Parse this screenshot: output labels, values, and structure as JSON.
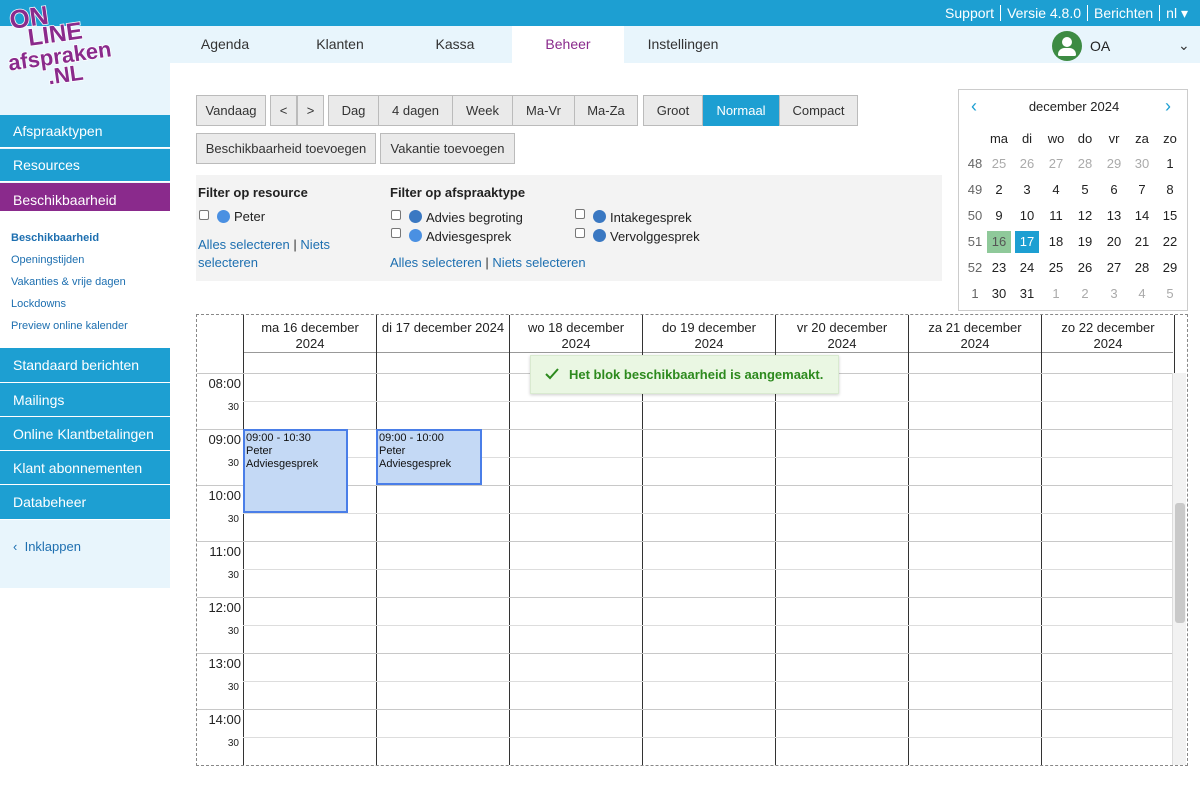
{
  "topbar": {
    "support": "Support",
    "version": "Versie 4.8.0",
    "messages": "Berichten",
    "lang": "nl ▾"
  },
  "logo": {
    "line1": "ON",
    "line2": "LINE",
    "line3": "afspraken",
    "line4": ".NL"
  },
  "nav": [
    "Agenda",
    "Klanten",
    "Kassa",
    "Beheer",
    "Instellingen"
  ],
  "user": {
    "initials": "OA"
  },
  "sidebar": {
    "top": [
      "Afspraaktypen",
      "Resources",
      "Beschikbaarheid"
    ],
    "sub": [
      "Beschikbaarheid",
      "Openingstijden",
      "Vakanties & vrije dagen",
      "Lockdowns",
      "Preview online kalender"
    ],
    "bottom": [
      "Standaard berichten",
      "Mailings",
      "Online Klantbetalingen",
      "Klant abonnementen",
      "Databeheer"
    ],
    "collapse": "Inklappen"
  },
  "toolbar": {
    "today": "Vandaag",
    "prev": "<",
    "next": ">",
    "views": [
      "Dag",
      "4 dagen",
      "Week",
      "Ma-Vr",
      "Ma-Za"
    ],
    "sizes": [
      "Groot",
      "Normaal",
      "Compact"
    ],
    "add_avail": "Beschikbaarheid toevoegen",
    "add_vac": "Vakantie toevoegen"
  },
  "filter": {
    "resource_title": "Filter op resource",
    "resources": [
      {
        "name": "Peter",
        "color": "#4a90e2"
      }
    ],
    "resource_links": {
      "all": "Alles selecteren",
      "sep": "|",
      "none": "Niets",
      "none2": "selecteren"
    },
    "type_title": "Filter op afspraaktype",
    "types": [
      {
        "name": "Advies begroting",
        "color": "#3a78c2"
      },
      {
        "name": "Intakegesprek",
        "color": "#3a78c2"
      },
      {
        "name": "Adviesgesprek",
        "color": "#4a90e2"
      },
      {
        "name": "Vervolggesprek",
        "color": "#3a78c2"
      }
    ],
    "type_links": {
      "all": "Alles selecteren",
      "sep": "|",
      "none": "Niets selecteren"
    }
  },
  "minical": {
    "month": "december 2024",
    "weekdays": [
      "ma",
      "di",
      "wo",
      "do",
      "vr",
      "za",
      "zo"
    ],
    "weeks": [
      {
        "wk": "48",
        "days": [
          "25",
          "26",
          "27",
          "28",
          "29",
          "30",
          "1"
        ]
      },
      {
        "wk": "49",
        "days": [
          "2",
          "3",
          "4",
          "5",
          "6",
          "7",
          "8"
        ]
      },
      {
        "wk": "50",
        "days": [
          "9",
          "10",
          "11",
          "12",
          "13",
          "14",
          "15"
        ]
      },
      {
        "wk": "51",
        "days": [
          "16",
          "17",
          "18",
          "19",
          "20",
          "21",
          "22"
        ]
      },
      {
        "wk": "52",
        "days": [
          "23",
          "24",
          "25",
          "26",
          "27",
          "28",
          "29"
        ]
      },
      {
        "wk": "1",
        "days": [
          "30",
          "31",
          "1",
          "2",
          "3",
          "4",
          "5"
        ]
      }
    ]
  },
  "calendar": {
    "days": [
      {
        "l1": "ma 16 december",
        "l2": "2024"
      },
      {
        "l1": "di 17 december 2024",
        "l2": ""
      },
      {
        "l1": "wo 18 december",
        "l2": "2024"
      },
      {
        "l1": "do 19 december",
        "l2": "2024"
      },
      {
        "l1": "vr 20 december",
        "l2": "2024"
      },
      {
        "l1": "za 21 december",
        "l2": "2024"
      },
      {
        "l1": "zo 22 december",
        "l2": "2024"
      }
    ],
    "hours": [
      "08:00",
      "09:00",
      "10:00",
      "11:00",
      "12:00",
      "13:00",
      "14:00"
    ],
    "half": "30",
    "events": [
      {
        "day": 0,
        "time": "09:00 - 10:30",
        "who": "Peter",
        "type": "Adviesgesprek",
        "start_min": 60,
        "dur_min": 90
      },
      {
        "day": 1,
        "time": "09:00 - 10:00",
        "who": "Peter",
        "type": "Adviesgesprek",
        "start_min": 60,
        "dur_min": 60
      }
    ]
  },
  "toast": "Het blok beschikbaarheid is aangemaakt.",
  "colors": {
    "primary": "#1d9fd2",
    "active_nav": "#8a2a8c",
    "event_bg": "#c4d9f5",
    "event_border": "#4a7ee8"
  }
}
